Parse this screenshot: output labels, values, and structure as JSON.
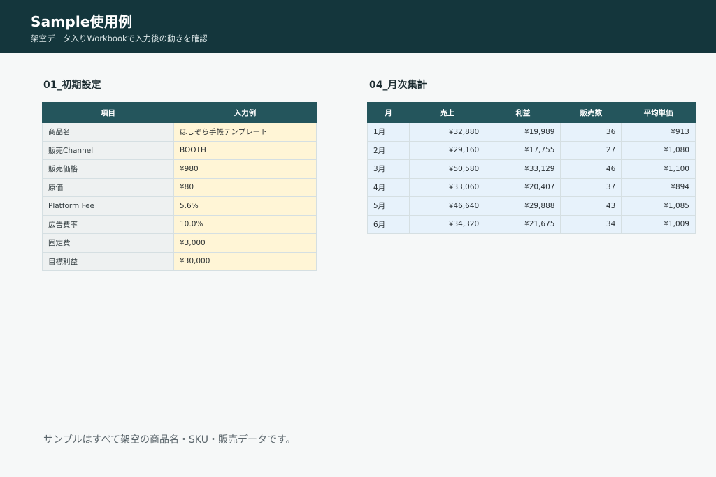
{
  "header": {
    "title": "Sample使用例",
    "subtitle": "架空データ入りWorkbookで入力後の動きを確認"
  },
  "settings": {
    "title": "01_初期設定",
    "columns": [
      "項目",
      "入力例"
    ],
    "rows": [
      [
        "商品名",
        "ほしぞら手帳テンプレート"
      ],
      [
        "販売Channel",
        "BOOTH"
      ],
      [
        "販売価格",
        "¥980"
      ],
      [
        "原価",
        "¥80"
      ],
      [
        "Platform Fee",
        "5.6%"
      ],
      [
        "広告費率",
        "10.0%"
      ],
      [
        "固定費",
        "¥3,000"
      ],
      [
        "目標利益",
        "¥30,000"
      ]
    ]
  },
  "monthly": {
    "title": "04_月次集計",
    "columns": [
      "月",
      "売上",
      "利益",
      "販売数",
      "平均単価"
    ],
    "rows": [
      [
        "1月",
        "¥32,880",
        "¥19,989",
        "36",
        "¥913"
      ],
      [
        "2月",
        "¥29,160",
        "¥17,755",
        "27",
        "¥1,080"
      ],
      [
        "3月",
        "¥50,580",
        "¥33,129",
        "46",
        "¥1,100"
      ],
      [
        "4月",
        "¥33,060",
        "¥20,407",
        "37",
        "¥894"
      ],
      [
        "5月",
        "¥46,640",
        "¥29,888",
        "43",
        "¥1,085"
      ],
      [
        "6月",
        "¥34,320",
        "¥21,675",
        "34",
        "¥1,009"
      ]
    ]
  },
  "footer": {
    "note": "サンプルはすべて架空の商品名・SKU・販売データです。"
  }
}
